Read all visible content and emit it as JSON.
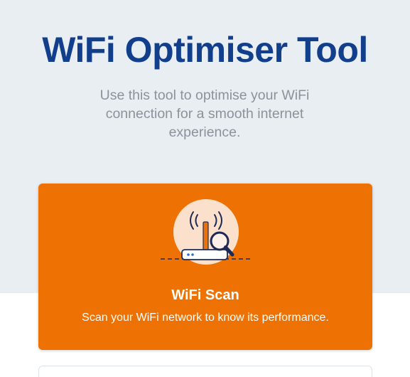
{
  "header": {
    "title": "WiFi Optimiser Tool",
    "subtitle": "Use this tool to optimise your WiFi connection for a smooth internet experience."
  },
  "cards": [
    {
      "title": "WiFi Scan",
      "description": "Scan your WiFi network to know its performance.",
      "icon": "wifi-router-scan-icon",
      "background_color": "#ee7203"
    }
  ],
  "colors": {
    "title": "#123f8c",
    "subtitle": "#8b929a",
    "hero_background": "#e9eef3",
    "accent": "#ee7203"
  }
}
